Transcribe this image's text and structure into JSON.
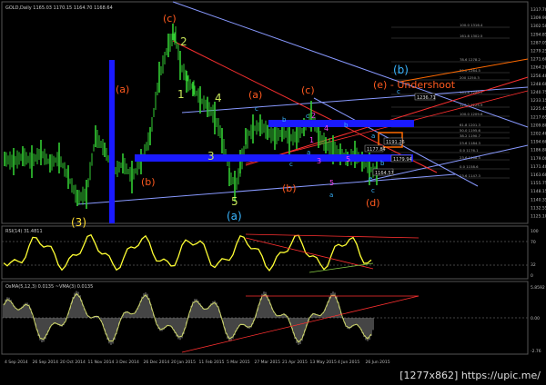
{
  "window": {
    "symbol_caption": "GOLD,Daily 1165.03 1170.15 1164.70 1168.64"
  },
  "panes": {
    "rsi_caption": "RSI(14) 31.4811",
    "osma_caption": "OsMA(5,12,3) 0.0135 ~VMA(3) 0.0135"
  },
  "price_axis": {
    "labels": [
      "1317.70",
      "1309.90",
      "1302.50",
      "1294.85",
      "1287.05",
      "1279.25",
      "1271.60",
      "1264.20",
      "1256.40",
      "1248.60",
      "1240.75",
      "1233.15",
      "1225.45",
      "1217.65",
      "1209.80",
      "1202.40",
      "1194.60",
      "1186.80",
      "1179.00",
      "1171.40",
      "1163.60",
      "1155.75",
      "1148.15",
      "1140.35",
      "1132.55",
      "1125.10"
    ]
  },
  "rsi_axis": {
    "labels": [
      "100",
      "70",
      "32",
      "0"
    ]
  },
  "osma_axis": {
    "labels": [
      "5.8592",
      "0.00",
      "-2.76"
    ]
  },
  "time_axis": {
    "labels": [
      "4 Sep 2014",
      "26 Sep 2014",
      "20 Oct 2014",
      "11 Nov 2014",
      "3 Dec 2014",
      "26 Dec 2014",
      "20 Jan 2015",
      "11 Feb 2015",
      "5 Mar 2015",
      "27 Mar 2015",
      "21 Apr 2015",
      "13 May 2015",
      "4 Jun 2015",
      "26 Jun 2015"
    ]
  },
  "price_tags": {
    "box1": "1191.26",
    "box2": "1179.94",
    "box3": "1164.57",
    "box4": "1236.71",
    "box5": "1177.84"
  },
  "fib_levels": [
    "100.0 1316.4",
    "161.8 1302.5",
    "78.6 1278.2",
    "50.0 1264.5",
    "200 1250.3",
    "161.8 1240.7",
    "127.2 1225.9",
    "100.0 1209.6",
    "61.8 1201.3",
    "50.0 1195.6",
    "38.2 1190.7",
    "23.6 1184.3",
    "0.0 1176.1",
    "23.6 1168.5",
    "0.0 1158.6",
    "23.6 1147.3"
  ],
  "wave_labels": {
    "c_top": "(c)",
    "two": "2",
    "one": "1",
    "four": "4",
    "a_left": "(a)",
    "three_top": "3",
    "b_left": "(b)",
    "five": "5",
    "a_bottom": "(a)",
    "three_bottom": "(3)",
    "a_mid": "(a)",
    "c_mid": "(c)",
    "b_mid": "(b)",
    "d_mid": "(d)",
    "b_circle": "(b)",
    "undershoot": "(e) - Undershoot",
    "small_a": "a",
    "small_b": "b",
    "small_c": "c",
    "small_d": "d",
    "small_e": "e",
    "m1": "1",
    "m2": "2",
    "m3": "3",
    "m4": "4",
    "m5": "5",
    "m5b": "5"
  },
  "colors": {
    "background": "#000000",
    "candle": "#33cc33",
    "blue_bar": "#1a1aff",
    "trend": "#8899ff",
    "red_line": "#ff3030",
    "orange": "#ff6a00",
    "yellow": "#ffff33",
    "olive": "#c8d06a",
    "label_orange": "#ff5a1f",
    "label_green": "#c8e65a",
    "label_cyan": "#39b5ff",
    "label_magenta": "#ff44ff"
  },
  "footer": {
    "text": "[1277x862] https://upic.me/"
  }
}
